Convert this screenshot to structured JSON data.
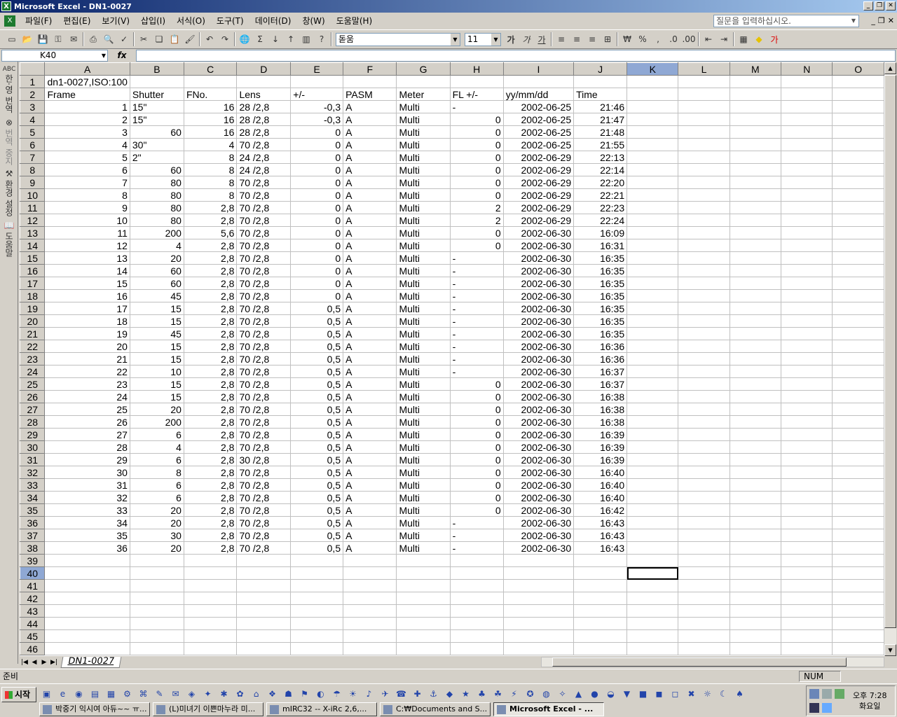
{
  "window": {
    "title": "Microsoft Excel - DN1-0027",
    "app_icon": "X"
  },
  "menu": [
    "파일(F)",
    "편집(E)",
    "보기(V)",
    "삽입(I)",
    "서식(O)",
    "도구(T)",
    "데이터(D)",
    "창(W)",
    "도움말(H)"
  ],
  "ask_box": {
    "placeholder": "질문을 입력하십시오."
  },
  "toolbar": {
    "font": "돋움",
    "size": "11",
    "zoom_icon_names": [
      "new-icon",
      "open-icon",
      "save-icon",
      "permission-icon",
      "print-icon",
      "preview-icon",
      "spell-icon",
      "cut-icon",
      "copy-icon",
      "paste-icon",
      "format-painter-icon",
      "undo-icon",
      "redo-icon",
      "hyperlink-icon",
      "autosum-icon",
      "sort-asc-icon",
      "sort-desc-icon",
      "chart-icon",
      "help-icon"
    ]
  },
  "namebox": "K40",
  "fx": "fx",
  "sidebar": [
    "한·영 번역",
    "번역 중지",
    "환경 설정",
    "도움말"
  ],
  "columns": [
    "A",
    "B",
    "C",
    "D",
    "E",
    "F",
    "G",
    "H",
    "I",
    "J",
    "K",
    "L",
    "M",
    "N",
    "O"
  ],
  "rows": [
    [
      "dn1-0027,ISO:100",
      "",
      "",
      "",
      "",
      "",
      "",
      "",
      "",
      ""
    ],
    [
      "Frame",
      "Shutter",
      "FNo.",
      "Lens",
      "+/-",
      "PASM",
      "Meter",
      "FL +/-",
      "yy/mm/dd",
      "Time"
    ],
    [
      "1",
      "15\"",
      "16",
      "28  /2,8",
      "-0,3",
      "A",
      "Multi",
      "-",
      "2002-06-25",
      "21:46"
    ],
    [
      "2",
      "15\"",
      "16",
      "28  /2,8",
      "-0,3",
      "A",
      "Multi",
      "0",
      "2002-06-25",
      "21:47"
    ],
    [
      "3",
      "60",
      "16",
      "28  /2,8",
      "0",
      "A",
      "Multi",
      "0",
      "2002-06-25",
      "21:48"
    ],
    [
      "4",
      "30\"",
      "4",
      "70  /2,8",
      "0",
      "A",
      "Multi",
      "0",
      "2002-06-25",
      "21:55"
    ],
    [
      "5",
      "2\"",
      "8",
      "24  /2,8",
      "0",
      "A",
      "Multi",
      "0",
      "2002-06-29",
      "22:13"
    ],
    [
      "6",
      "60",
      "8",
      "24  /2,8",
      "0",
      "A",
      "Multi",
      "0",
      "2002-06-29",
      "22:14"
    ],
    [
      "7",
      "80",
      "8",
      "70  /2,8",
      "0",
      "A",
      "Multi",
      "0",
      "2002-06-29",
      "22:20"
    ],
    [
      "8",
      "80",
      "8",
      "70  /2,8",
      "0",
      "A",
      "Multi",
      "0",
      "2002-06-29",
      "22:21"
    ],
    [
      "9",
      "80",
      "2,8",
      "70  /2,8",
      "0",
      "A",
      "Multi",
      "2",
      "2002-06-29",
      "22:23"
    ],
    [
      "10",
      "80",
      "2,8",
      "70  /2,8",
      "0",
      "A",
      "Multi",
      "2",
      "2002-06-29",
      "22:24"
    ],
    [
      "11",
      "200",
      "5,6",
      "70  /2,8",
      "0",
      "A",
      "Multi",
      "0",
      "2002-06-30",
      "16:09"
    ],
    [
      "12",
      "4",
      "2,8",
      "70  /2,8",
      "0",
      "A",
      "Multi",
      "0",
      "2002-06-30",
      "16:31"
    ],
    [
      "13",
      "20",
      "2,8",
      "70  /2,8",
      "0",
      "A",
      "Multi",
      "-",
      "2002-06-30",
      "16:35"
    ],
    [
      "14",
      "60",
      "2,8",
      "70  /2,8",
      "0",
      "A",
      "Multi",
      "-",
      "2002-06-30",
      "16:35"
    ],
    [
      "15",
      "60",
      "2,8",
      "70  /2,8",
      "0",
      "A",
      "Multi",
      "-",
      "2002-06-30",
      "16:35"
    ],
    [
      "16",
      "45",
      "2,8",
      "70  /2,8",
      "0",
      "A",
      "Multi",
      "-",
      "2002-06-30",
      "16:35"
    ],
    [
      "17",
      "15",
      "2,8",
      "70  /2,8",
      "0,5",
      "A",
      "Multi",
      "-",
      "2002-06-30",
      "16:35"
    ],
    [
      "18",
      "15",
      "2,8",
      "70  /2,8",
      "0,5",
      "A",
      "Multi",
      "-",
      "2002-06-30",
      "16:35"
    ],
    [
      "19",
      "45",
      "2,8",
      "70  /2,8",
      "0,5",
      "A",
      "Multi",
      "-",
      "2002-06-30",
      "16:35"
    ],
    [
      "20",
      "15",
      "2,8",
      "70  /2,8",
      "0,5",
      "A",
      "Multi",
      "-",
      "2002-06-30",
      "16:36"
    ],
    [
      "21",
      "15",
      "2,8",
      "70  /2,8",
      "0,5",
      "A",
      "Multi",
      "-",
      "2002-06-30",
      "16:36"
    ],
    [
      "22",
      "10",
      "2,8",
      "70  /2,8",
      "0,5",
      "A",
      "Multi",
      "-",
      "2002-06-30",
      "16:37"
    ],
    [
      "23",
      "15",
      "2,8",
      "70  /2,8",
      "0,5",
      "A",
      "Multi",
      "0",
      "2002-06-30",
      "16:37"
    ],
    [
      "24",
      "15",
      "2,8",
      "70  /2,8",
      "0,5",
      "A",
      "Multi",
      "0",
      "2002-06-30",
      "16:38"
    ],
    [
      "25",
      "20",
      "2,8",
      "70  /2,8",
      "0,5",
      "A",
      "Multi",
      "0",
      "2002-06-30",
      "16:38"
    ],
    [
      "26",
      "200",
      "2,8",
      "70  /2,8",
      "0,5",
      "A",
      "Multi",
      "0",
      "2002-06-30",
      "16:38"
    ],
    [
      "27",
      "6",
      "2,8",
      "70  /2,8",
      "0,5",
      "A",
      "Multi",
      "0",
      "2002-06-30",
      "16:39"
    ],
    [
      "28",
      "4",
      "2,8",
      "70  /2,8",
      "0,5",
      "A",
      "Multi",
      "0",
      "2002-06-30",
      "16:39"
    ],
    [
      "29",
      "6",
      "2,8",
      "30  /2,8",
      "0,5",
      "A",
      "Multi",
      "0",
      "2002-06-30",
      "16:39"
    ],
    [
      "30",
      "8",
      "2,8",
      "70  /2,8",
      "0,5",
      "A",
      "Multi",
      "0",
      "2002-06-30",
      "16:40"
    ],
    [
      "31",
      "6",
      "2,8",
      "70  /2,8",
      "0,5",
      "A",
      "Multi",
      "0",
      "2002-06-30",
      "16:40"
    ],
    [
      "32",
      "6",
      "2,8",
      "70  /2,8",
      "0,5",
      "A",
      "Multi",
      "0",
      "2002-06-30",
      "16:40"
    ],
    [
      "33",
      "20",
      "2,8",
      "70  /2,8",
      "0,5",
      "A",
      "Multi",
      "0",
      "2002-06-30",
      "16:42"
    ],
    [
      "34",
      "20",
      "2,8",
      "70  /2,8",
      "0,5",
      "A",
      "Multi",
      "-",
      "2002-06-30",
      "16:43"
    ],
    [
      "35",
      "30",
      "2,8",
      "70  /2,8",
      "0,5",
      "A",
      "Multi",
      "-",
      "2002-06-30",
      "16:43"
    ],
    [
      "36",
      "20",
      "2,8",
      "70  /2,8",
      "0,5",
      "A",
      "Multi",
      "-",
      "2002-06-30",
      "16:43"
    ]
  ],
  "total_rows": 46,
  "selected": {
    "col": "K",
    "row": 40
  },
  "sheet_tab": "DN1-0027",
  "status": {
    "ready": "준비",
    "num": "NUM"
  },
  "taskbar": {
    "start": "시작",
    "tasks": [
      "박중기 익시여 아듀~~ ㅠ...",
      "(L)미녀기 이쁜마누라 미...",
      "mIRC32 -- X-iRc 2,6,...",
      "C:₩Documents and S...",
      "Microsoft Excel - ..."
    ],
    "active_task": 4,
    "clock_time": "오후 7:28",
    "clock_day": "화요일"
  }
}
